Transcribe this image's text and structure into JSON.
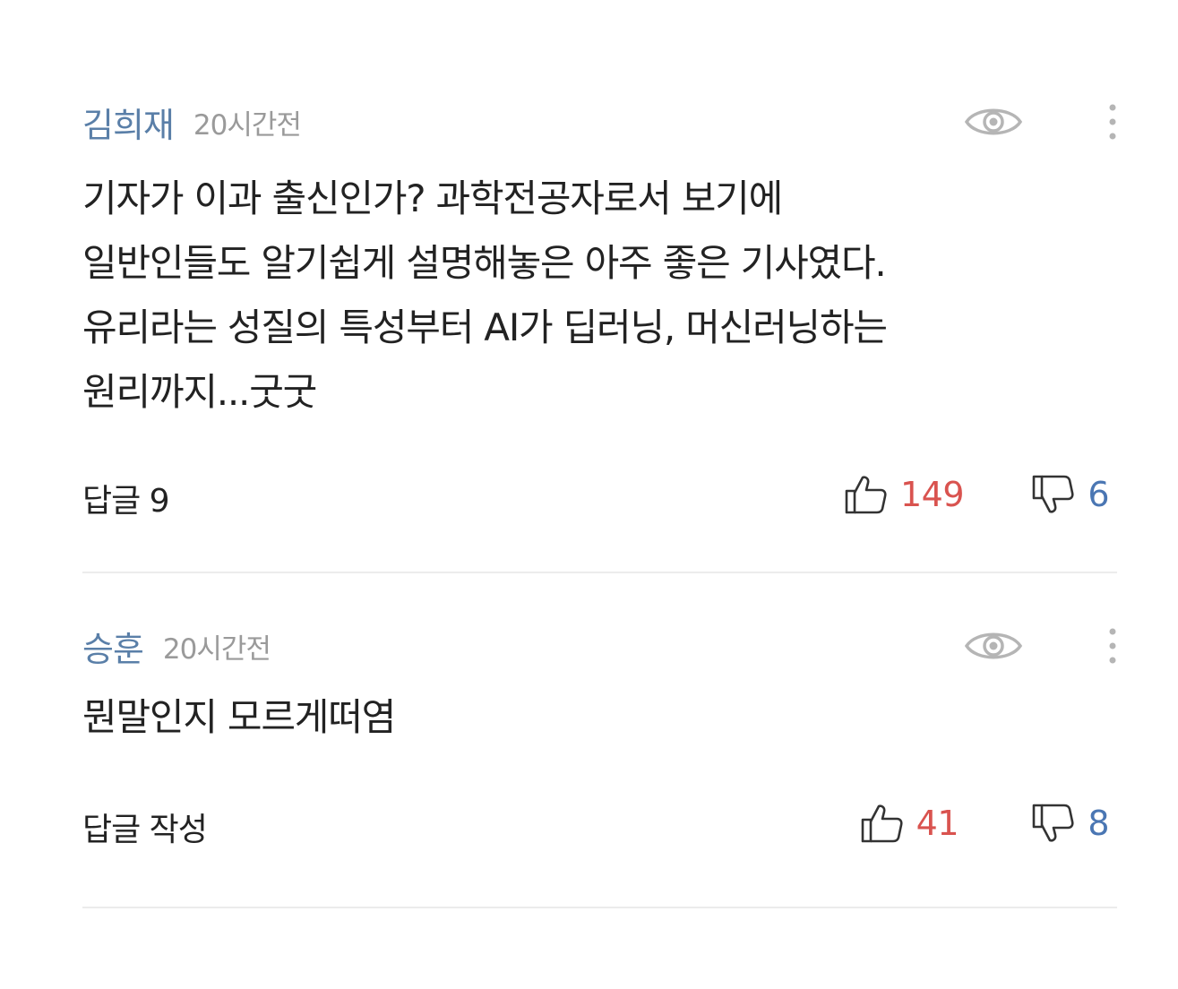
{
  "comments": [
    {
      "author": "김희재",
      "time": "20시간전",
      "text": "기자가 이과 출신인가? 과학전공자로서 보기에\n일반인들도 알기쉽게 설명해놓은 아주 좋은 기사였다.\n유리라는 성질의 특성부터 AI가 딥러닝, 머신러닝하는\n원리까지...굿굿",
      "reply_label": "답글 9",
      "likes": "149",
      "dislikes": "6"
    },
    {
      "author": "승훈",
      "time": "20시간전",
      "text": "뭔말인지 모르게떠염",
      "reply_label": "답글 작성",
      "likes": "41",
      "dislikes": "8"
    }
  ],
  "icons": {
    "view": "eye-icon",
    "more": "more-vertical-icon",
    "like": "thumbs-up-icon",
    "dislike": "thumbs-down-icon"
  },
  "colors": {
    "author": "#5a7fa8",
    "likes": "#d9534f",
    "dislikes": "#4a76b3",
    "time": "#9a9a9a"
  }
}
